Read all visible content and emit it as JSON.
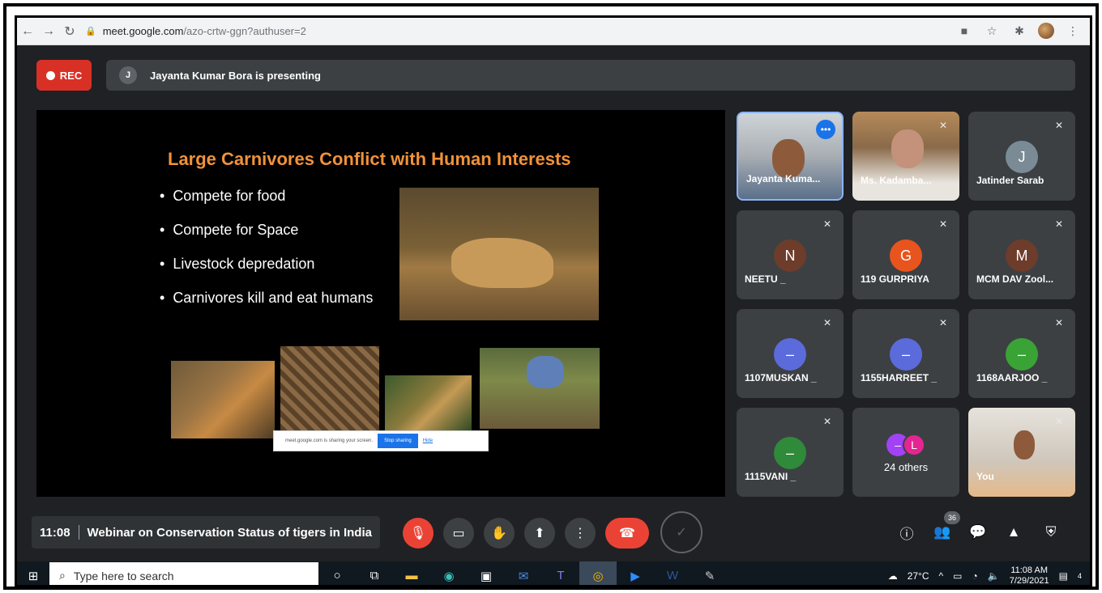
{
  "browser": {
    "url_host": "meet.google.com",
    "url_path": "/azo-crtw-ggn?authuser=2",
    "icons": [
      "back-arrow-icon",
      "forward-arrow-icon",
      "reload-icon",
      "lock-icon",
      "camera-icon",
      "star-icon",
      "extensions-icon",
      "profile-avatar",
      "menu-kebab-icon"
    ]
  },
  "meet": {
    "rec_label": "REC",
    "presenter_initial": "J",
    "presenting_text": "Jayanta Kumar Bora is presenting"
  },
  "slide": {
    "title": "Large Carnivores Conflict with Human Interests",
    "bullets": [
      "Compete for food",
      "Compete for Space",
      "Livestock depredation",
      "Carnivores kill and eat humans"
    ],
    "share_notice": "meet.google.com is sharing your screen.",
    "stop_label": "Stop sharing",
    "hide_label": "Hide"
  },
  "participants": [
    {
      "name": "Jayanta Kuma...",
      "type": "video"
    },
    {
      "name": "Ms. Kadamba...",
      "type": "video"
    },
    {
      "name": "Jatinder Sarab",
      "initial": "J",
      "color": "#7a8b96"
    },
    {
      "name": "NEETU _",
      "initial": "N",
      "color": "#6d3c2a"
    },
    {
      "name": "119 GURPRIYA",
      "initial": "G",
      "color": "#e8541e"
    },
    {
      "name": "MCM DAV Zool...",
      "initial": "M",
      "color": "#6d3c2a"
    },
    {
      "name": "1107MUSKAN _",
      "initial": "–",
      "color": "#5b6bdc"
    },
    {
      "name": "1155HARREET _",
      "initial": "–",
      "color": "#5b6bdc"
    },
    {
      "name": "1168AARJOO _",
      "initial": "–",
      "color": "#3aa335"
    },
    {
      "name": "1115VANI _",
      "initial": "–",
      "color": "#2f8a3a"
    },
    {
      "others_label": "24 others",
      "c1": "–",
      "c2": "L"
    },
    {
      "name": "You",
      "type": "video"
    }
  ],
  "controls": {
    "time": "11:08",
    "meeting_title": "Webinar on Conservation Status of tigers in India",
    "people_count": "36"
  },
  "taskbar": {
    "search_placeholder": "Type here to search",
    "temperature": "27°C",
    "time": "11:08 AM",
    "date": "7/29/2021",
    "notif_count": "4"
  },
  "colors": {
    "accent_blue": "#1a73e8",
    "record_red": "#d93025",
    "slide_title_orange": "#f0923a",
    "meet_bg": "#202124",
    "tile_bg": "#3c4043"
  }
}
